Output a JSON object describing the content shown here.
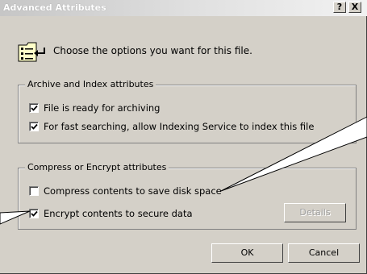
{
  "window": {
    "title": "Advanced Attributes",
    "help_label": "?",
    "close_label": "X"
  },
  "header": {
    "text": "Choose the options you want for this file.",
    "icon": "file-properties-icon"
  },
  "archive_group": {
    "label": "Archive and Index attributes",
    "items": [
      {
        "label": "File is ready for archiving",
        "checked": true
      },
      {
        "label": "For fast searching, allow Indexing Service to index this file",
        "checked": true
      }
    ]
  },
  "compress_group": {
    "label": "Compress or Encrypt attributes",
    "items": [
      {
        "label": "Compress contents to save disk space",
        "checked": false
      },
      {
        "label": "Encrypt contents to secure data",
        "checked": true
      }
    ],
    "details_label": "Details"
  },
  "buttons": {
    "ok_label": "OK",
    "cancel_label": "Cancel"
  }
}
